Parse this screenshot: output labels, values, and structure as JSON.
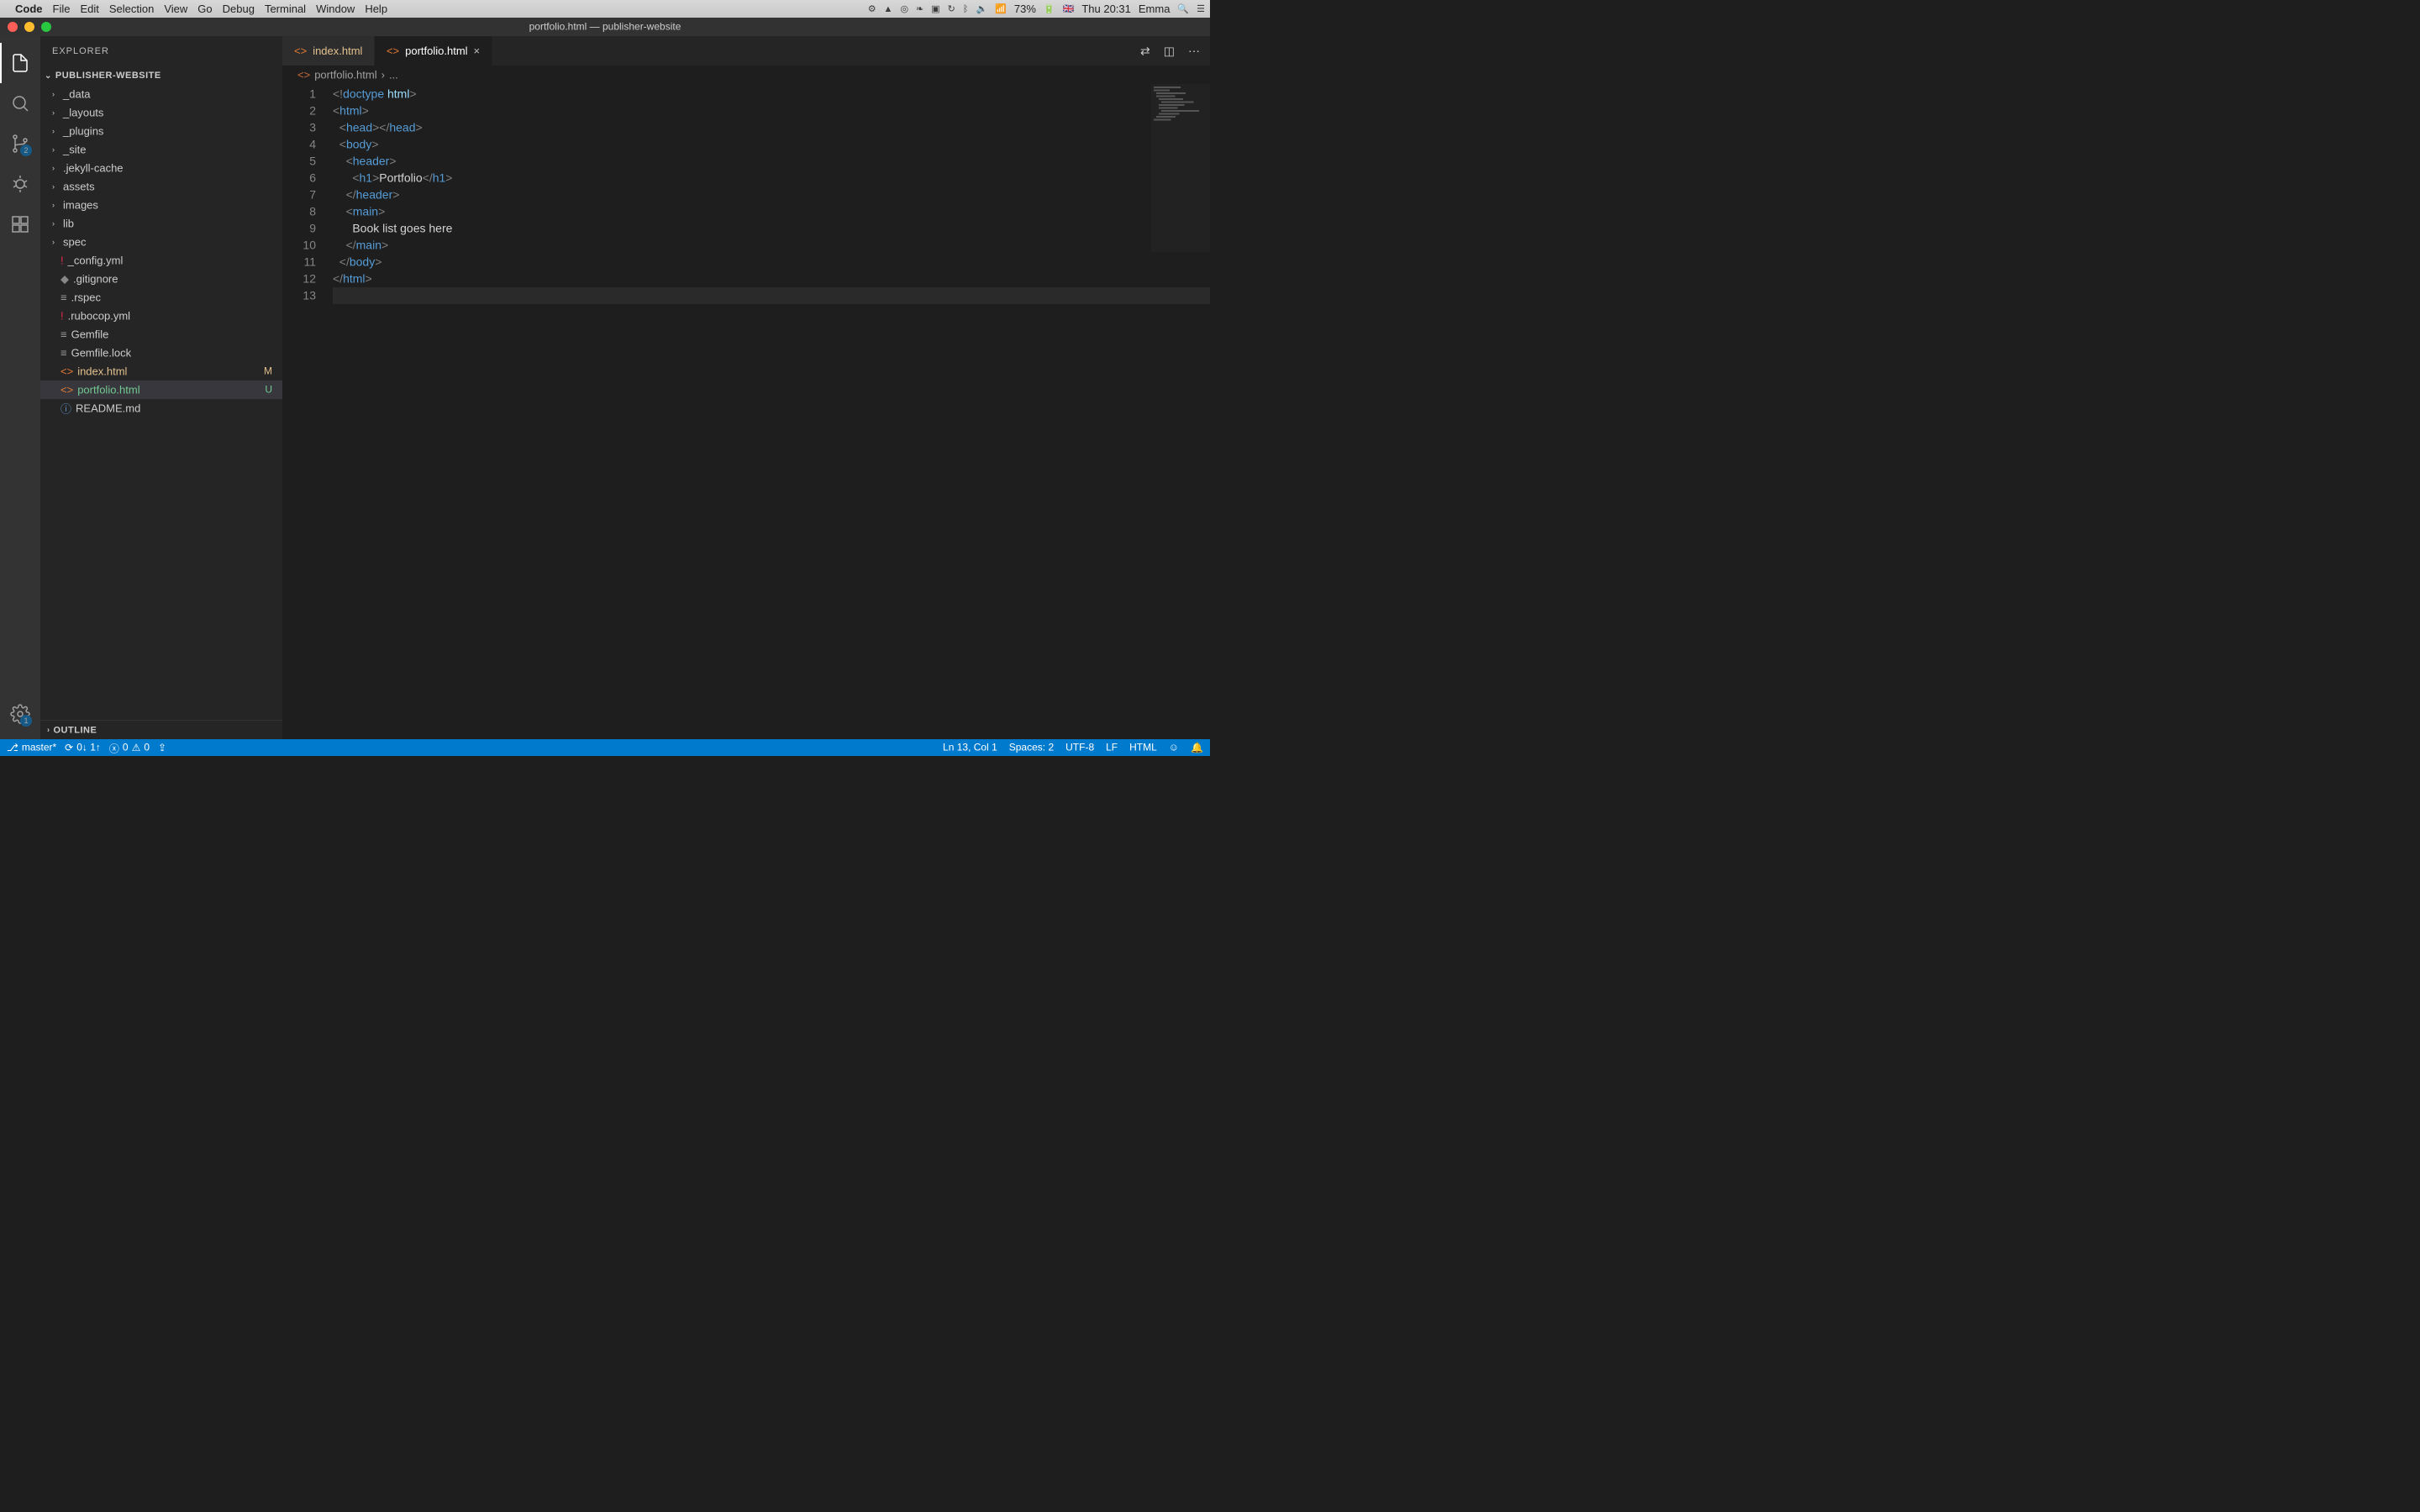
{
  "macos": {
    "app_name": "Code",
    "menus": [
      "File",
      "Edit",
      "Selection",
      "View",
      "Go",
      "Debug",
      "Terminal",
      "Window",
      "Help"
    ],
    "battery": "73%",
    "clock": "Thu 20:31",
    "user": "Emma"
  },
  "titlebar": {
    "title": "portfolio.html — publisher-website"
  },
  "activity": {
    "scm_badge": "2",
    "settings_badge": "1"
  },
  "sidebar": {
    "header": "EXPLORER",
    "project": "PUBLISHER-WEBSITE",
    "folders": [
      {
        "name": "_data"
      },
      {
        "name": "_layouts"
      },
      {
        "name": "_plugins"
      },
      {
        "name": "_site"
      },
      {
        "name": ".jekyll-cache"
      },
      {
        "name": "assets"
      },
      {
        "name": "images"
      },
      {
        "name": "lib"
      },
      {
        "name": "spec"
      }
    ],
    "files": [
      {
        "name": "_config.yml",
        "icon": "yaml"
      },
      {
        "name": ".gitignore",
        "icon": "git"
      },
      {
        "name": ".rspec",
        "icon": "text"
      },
      {
        "name": ".rubocop.yml",
        "icon": "yaml"
      },
      {
        "name": "Gemfile",
        "icon": "text"
      },
      {
        "name": "Gemfile.lock",
        "icon": "text"
      },
      {
        "name": "index.html",
        "icon": "html",
        "status": "M",
        "modified": true
      },
      {
        "name": "portfolio.html",
        "icon": "html",
        "status": "U",
        "untracked": true,
        "selected": true
      },
      {
        "name": "README.md",
        "icon": "info"
      }
    ],
    "outline": "OUTLINE"
  },
  "tabs": [
    {
      "label": "index.html",
      "modified": true
    },
    {
      "label": "portfolio.html",
      "active": true
    }
  ],
  "breadcrumb": {
    "file": "portfolio.html",
    "rest": "..."
  },
  "editor": {
    "lines": [
      {
        "n": 1,
        "indent": 0,
        "tokens": [
          [
            "brack",
            "<!"
          ],
          [
            "doctype",
            "doctype"
          ],
          [
            "text",
            " "
          ],
          [
            "attr",
            "html"
          ],
          [
            "brack",
            ">"
          ]
        ]
      },
      {
        "n": 2,
        "indent": 0,
        "tokens": [
          [
            "brack",
            "<"
          ],
          [
            "tag",
            "html"
          ],
          [
            "brack",
            ">"
          ]
        ]
      },
      {
        "n": 3,
        "indent": 1,
        "tokens": [
          [
            "brack",
            "<"
          ],
          [
            "tag",
            "head"
          ],
          [
            "brack",
            "></"
          ],
          [
            "tag",
            "head"
          ],
          [
            "brack",
            ">"
          ]
        ]
      },
      {
        "n": 4,
        "indent": 1,
        "tokens": [
          [
            "brack",
            "<"
          ],
          [
            "tag",
            "body"
          ],
          [
            "brack",
            ">"
          ]
        ]
      },
      {
        "n": 5,
        "indent": 2,
        "tokens": [
          [
            "brack",
            "<"
          ],
          [
            "tag",
            "header"
          ],
          [
            "brack",
            ">"
          ]
        ]
      },
      {
        "n": 6,
        "indent": 3,
        "tokens": [
          [
            "brack",
            "<"
          ],
          [
            "tag",
            "h1"
          ],
          [
            "brack",
            ">"
          ],
          [
            "text",
            "Portfolio"
          ],
          [
            "brack",
            "</"
          ],
          [
            "tag",
            "h1"
          ],
          [
            "brack",
            ">"
          ]
        ]
      },
      {
        "n": 7,
        "indent": 2,
        "tokens": [
          [
            "brack",
            "</"
          ],
          [
            "tag",
            "header"
          ],
          [
            "brack",
            ">"
          ]
        ]
      },
      {
        "n": 8,
        "indent": 2,
        "tokens": [
          [
            "brack",
            "<"
          ],
          [
            "tag",
            "main"
          ],
          [
            "brack",
            ">"
          ]
        ]
      },
      {
        "n": 9,
        "indent": 3,
        "tokens": [
          [
            "text",
            "Book list goes here"
          ]
        ]
      },
      {
        "n": 10,
        "indent": 2,
        "tokens": [
          [
            "brack",
            "</"
          ],
          [
            "tag",
            "main"
          ],
          [
            "brack",
            ">"
          ]
        ]
      },
      {
        "n": 11,
        "indent": 1,
        "tokens": [
          [
            "brack",
            "</"
          ],
          [
            "tag",
            "body"
          ],
          [
            "brack",
            ">"
          ]
        ]
      },
      {
        "n": 12,
        "indent": 0,
        "tokens": [
          [
            "brack",
            "</"
          ],
          [
            "tag",
            "html"
          ],
          [
            "brack",
            ">"
          ]
        ]
      },
      {
        "n": 13,
        "indent": 0,
        "tokens": [],
        "current": true
      }
    ]
  },
  "statusbar": {
    "branch": "master*",
    "sync": "0↓ 1↑",
    "errors": "0",
    "warnings": "0",
    "cursor": "Ln 13, Col 1",
    "spaces": "Spaces: 2",
    "encoding": "UTF-8",
    "eol": "LF",
    "language": "HTML"
  }
}
